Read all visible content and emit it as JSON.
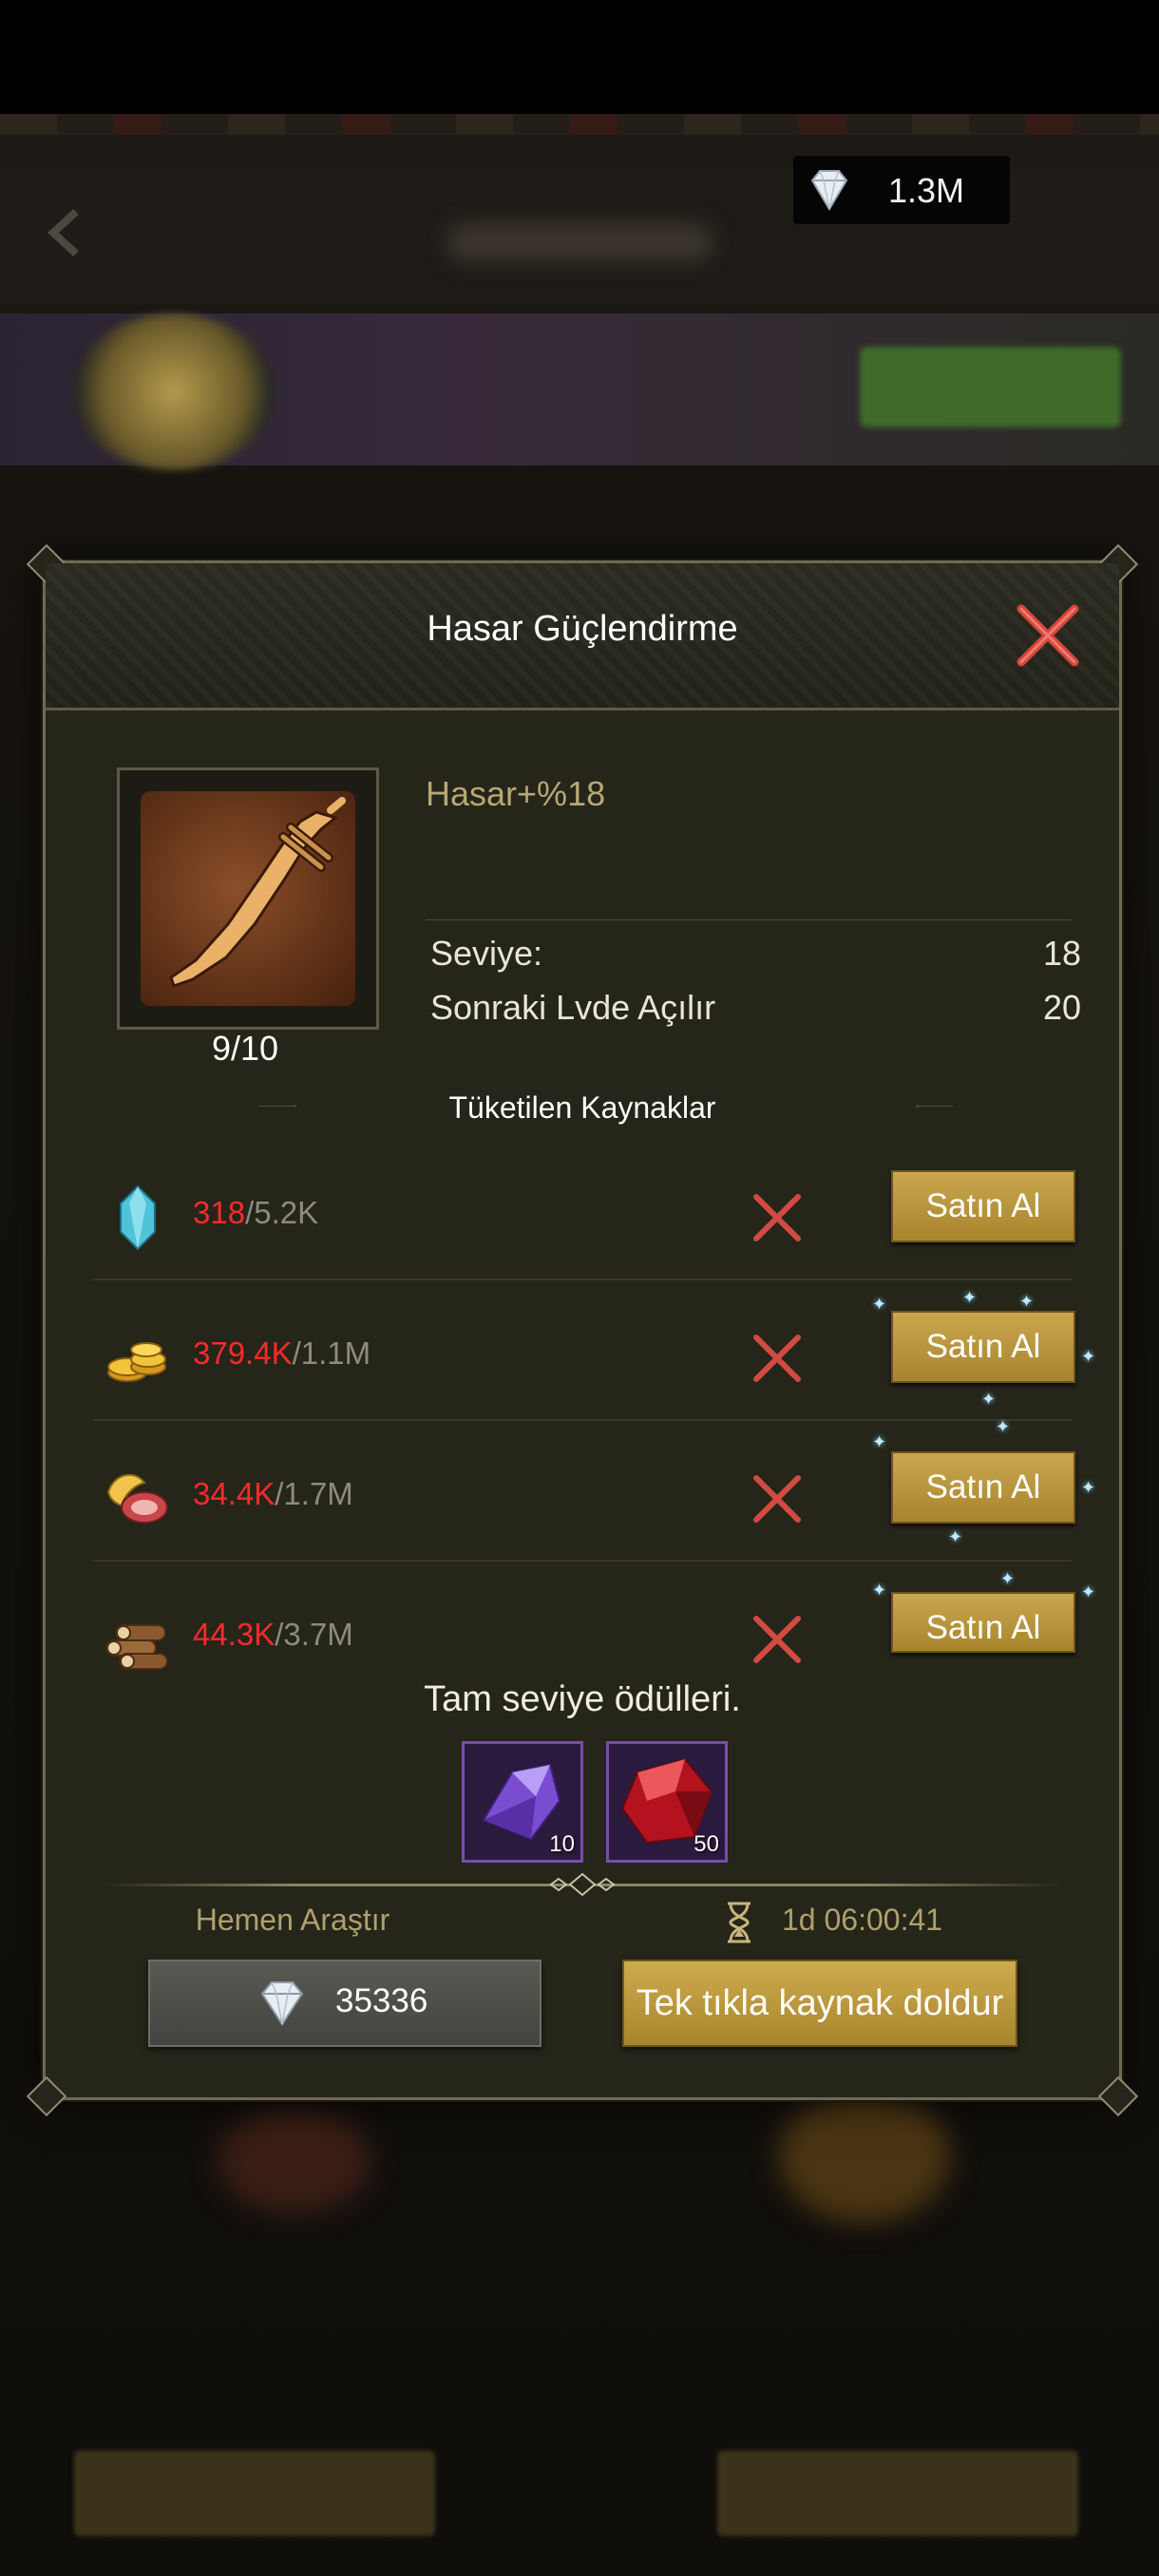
{
  "top_bar": {
    "diamonds": "1.3M"
  },
  "dialog": {
    "title": "Hasar Güçlendirme",
    "progress": "9/10",
    "bonus": "Hasar+%18",
    "stats": [
      {
        "label": "Seviye:",
        "value": "18"
      },
      {
        "label": "Sonraki Lvde Açılır",
        "value": "20"
      }
    ],
    "section_title": "Tüketilen Kaynaklar",
    "resources": [
      {
        "icon": "crystal-icon",
        "have": "318",
        "need": "/5.2K",
        "buy_label": "Satın Al"
      },
      {
        "icon": "gold-coins-icon",
        "have": "379.4K",
        "need": "/1.1M",
        "buy_label": "Satın Al"
      },
      {
        "icon": "food-icon",
        "have": "34.4K",
        "need": "/1.7M",
        "buy_label": "Satın Al"
      },
      {
        "icon": "wood-logs-icon",
        "have": "44.3K",
        "need": "/3.7M",
        "buy_label": "Satın Al"
      }
    ],
    "reward_title": "Tam seviye ödülleri.",
    "rewards": [
      {
        "icon": "purple-crystal-icon",
        "count": "10"
      },
      {
        "icon": "red-gem-icon",
        "count": "50"
      }
    ],
    "instant_label": "Hemen Araştır",
    "timer": "1d 06:00:41",
    "gem_cost": "35336",
    "fill_button": "Tek tıkla kaynak doldur"
  },
  "colors": {
    "accent_gold": "#c9a74e",
    "shortage_red": "#ff2a2a",
    "panel": "#252519"
  }
}
